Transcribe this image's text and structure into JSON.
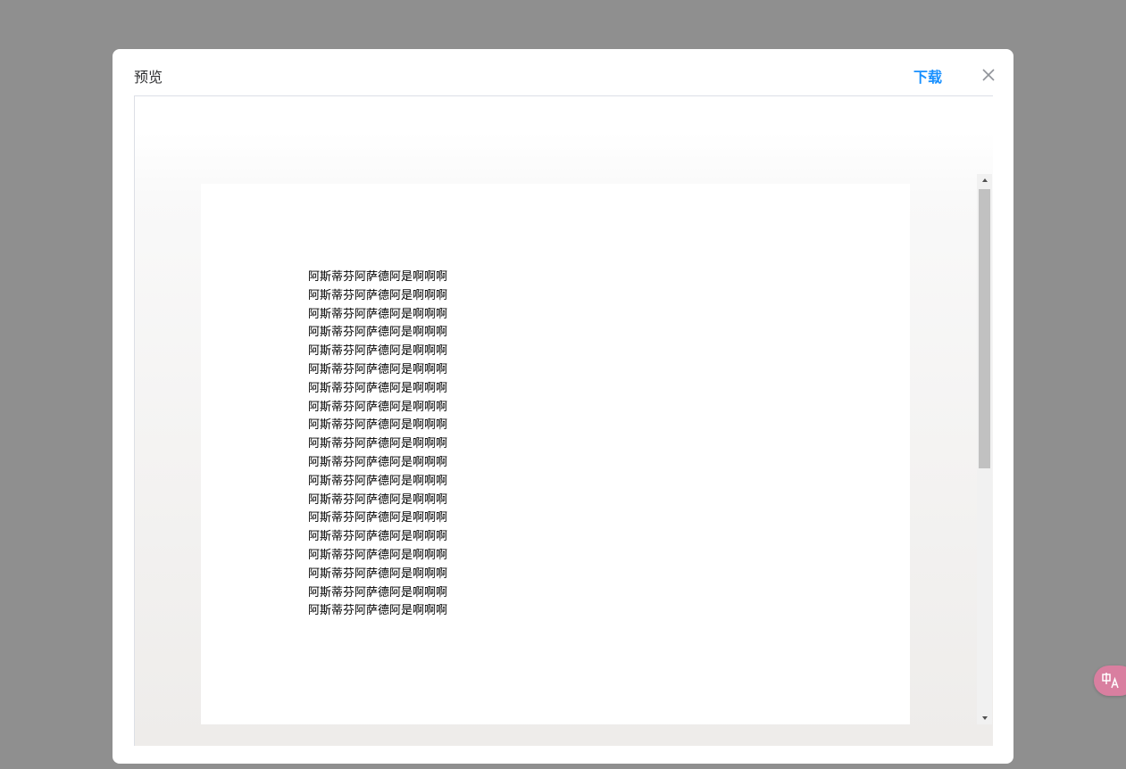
{
  "dialog": {
    "title": "预览",
    "download_label": "下载"
  },
  "document": {
    "lines": [
      "阿斯蒂芬阿萨德阿是啊啊啊",
      "阿斯蒂芬阿萨德阿是啊啊啊",
      "阿斯蒂芬阿萨德阿是啊啊啊",
      "阿斯蒂芬阿萨德阿是啊啊啊",
      "阿斯蒂芬阿萨德阿是啊啊啊",
      "阿斯蒂芬阿萨德阿是啊啊啊",
      "阿斯蒂芬阿萨德阿是啊啊啊",
      "阿斯蒂芬阿萨德阿是啊啊啊",
      "阿斯蒂芬阿萨德阿是啊啊啊",
      "阿斯蒂芬阿萨德阿是啊啊啊",
      "阿斯蒂芬阿萨德阿是啊啊啊",
      "阿斯蒂芬阿萨德阿是啊啊啊",
      "阿斯蒂芬阿萨德阿是啊啊啊",
      "阿斯蒂芬阿萨德阿是啊啊啊",
      "阿斯蒂芬阿萨德阿是啊啊啊",
      "阿斯蒂芬阿萨德阿是啊啊啊",
      "阿斯蒂芬阿萨德阿是啊啊啊",
      "阿斯蒂芬阿萨德阿是啊啊啊",
      "阿斯蒂芬阿萨德阿是啊啊啊"
    ]
  },
  "icons": {
    "close": "close-icon",
    "scroll_up": "triangle-up-icon",
    "scroll_down": "triangle-down-icon",
    "translate": "translate-icon"
  },
  "colors": {
    "accent": "#1890ff",
    "overlay": "#8f8f8f",
    "translate_fab": "#d97fa0"
  }
}
